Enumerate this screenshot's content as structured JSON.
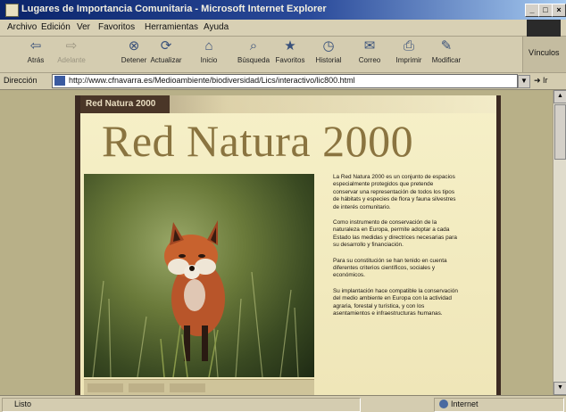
{
  "window": {
    "title": "Lugares de Importancia Comunitaria - Microsoft Internet Explorer",
    "controls": {
      "minimize": "_",
      "maximize": "□",
      "close": "×"
    }
  },
  "menu": [
    "Archivo",
    "Edición",
    "Ver",
    "Favoritos",
    "Herramientas",
    "Ayuda"
  ],
  "toolbar": {
    "buttons": [
      {
        "label": "Atrás",
        "icon": "back-arrow-icon",
        "glyph": "⇦"
      },
      {
        "label": "Adelante",
        "icon": "forward-arrow-icon",
        "glyph": "⇨"
      },
      {
        "label": "Detener",
        "icon": "stop-icon",
        "glyph": "⊗"
      },
      {
        "label": "Actualizar",
        "icon": "refresh-icon",
        "glyph": "⟳"
      },
      {
        "label": "Inicio",
        "icon": "home-icon",
        "glyph": "⌂"
      },
      {
        "label": "Búsqueda",
        "icon": "search-icon",
        "glyph": "⌕"
      },
      {
        "label": "Favoritos",
        "icon": "favorites-icon",
        "glyph": "★"
      },
      {
        "label": "Historial",
        "icon": "history-icon",
        "glyph": "◷"
      },
      {
        "label": "Correo",
        "icon": "mail-icon",
        "glyph": "✉"
      },
      {
        "label": "Imprimir",
        "icon": "print-icon",
        "glyph": "⎙"
      },
      {
        "label": "Modificar",
        "icon": "edit-icon",
        "glyph": "✎"
      }
    ],
    "links_label": "Vínculos"
  },
  "address": {
    "label": "Dirección",
    "url": "http://www.cfnavarra.es/Medioambiente/biodiversidad/Lics/interactivo/lic800.html",
    "go_label": "Ir"
  },
  "page": {
    "tab_label": "Red Natura 2000",
    "heading": "Red Natura 2000",
    "paragraphs": [
      "La Red Natura 2000 es un conjunto de espacios especialmente protegidos que pretende conservar una representación de todos los tipos de hábitats y especies de flora y fauna silvestres de interés comunitario.",
      "Como instrumento de conservación de la naturaleza en Europa, permite adoptar a cada Estado las medidas y directrices necesarias para su desarrollo y financiación.",
      "Para su constitución se han tenido en cuenta diferentes criterios científicos, sociales y económicos.",
      "Su implantación hace compatible la conservación del medio ambiente en Europa con la actividad agraria, forestal y turística, y con los asentamientos e infraestructuras humanas."
    ]
  },
  "status": {
    "text": "Listo",
    "zone": "Internet"
  },
  "colors": {
    "title_bar": "#0a246a",
    "page_background": "#f6f0c8",
    "heading": "#8a7440",
    "frame": "#3c2a22"
  }
}
